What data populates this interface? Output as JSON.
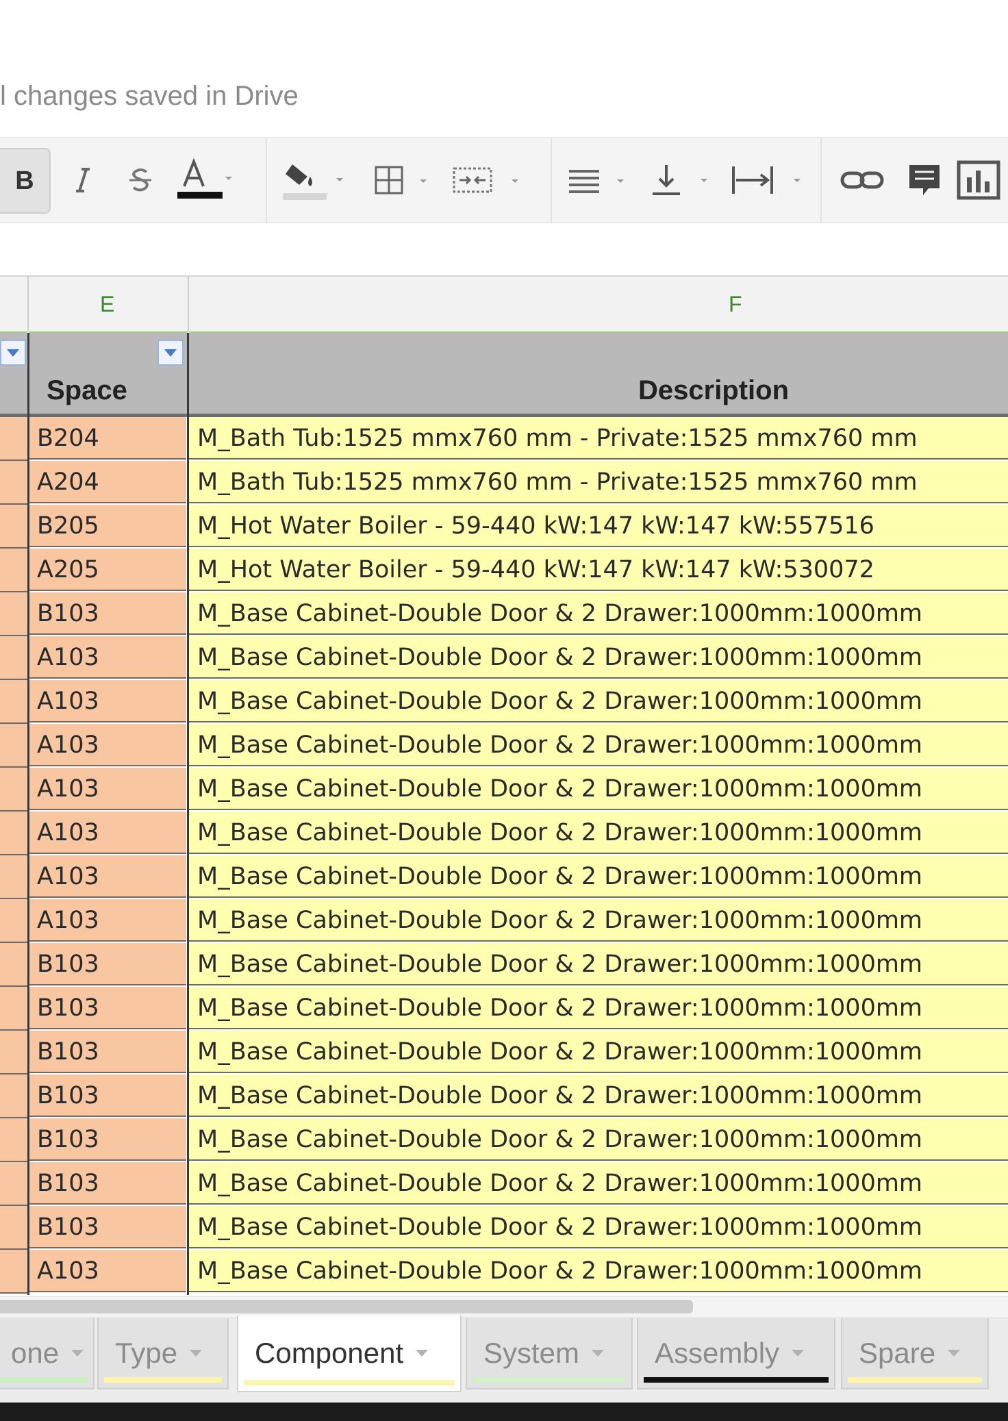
{
  "status": {
    "text": "l changes saved in Drive"
  },
  "toolbar": {
    "bold_label": "B",
    "text_color": "#111111",
    "fill_color": "#d6d6d6",
    "icons": [
      "italic-icon",
      "strikethrough-icon",
      "text-color-icon",
      "fill-color-icon",
      "borders-icon",
      "merge-cells-icon",
      "horizontal-align-icon",
      "vertical-align-icon",
      "text-wrap-icon",
      "link-icon",
      "comment-icon",
      "chart-icon"
    ]
  },
  "columns": {
    "e": "E",
    "f": "F"
  },
  "header": {
    "space": "Space",
    "description": "Description"
  },
  "rows": [
    {
      "space": "B204",
      "description": "M_Bath Tub:1525 mmx760 mm - Private:1525 mmx760 mm"
    },
    {
      "space": "A204",
      "description": "M_Bath Tub:1525 mmx760 mm - Private:1525 mmx760 mm"
    },
    {
      "space": "B205",
      "description": "M_Hot Water Boiler - 59-440 kW:147 kW:147 kW:557516"
    },
    {
      "space": "A205",
      "description": "M_Hot Water Boiler - 59-440 kW:147 kW:147 kW:530072"
    },
    {
      "space": "B103",
      "description": "M_Base Cabinet-Double Door & 2 Drawer:1000mm:1000mm"
    },
    {
      "space": "A103",
      "description": "M_Base Cabinet-Double Door & 2 Drawer:1000mm:1000mm"
    },
    {
      "space": "A103",
      "description": "M_Base Cabinet-Double Door & 2 Drawer:1000mm:1000mm"
    },
    {
      "space": "A103",
      "description": "M_Base Cabinet-Double Door & 2 Drawer:1000mm:1000mm"
    },
    {
      "space": "A103",
      "description": "M_Base Cabinet-Double Door & 2 Drawer:1000mm:1000mm"
    },
    {
      "space": "A103",
      "description": "M_Base Cabinet-Double Door & 2 Drawer:1000mm:1000mm"
    },
    {
      "space": "A103",
      "description": "M_Base Cabinet-Double Door & 2 Drawer:1000mm:1000mm"
    },
    {
      "space": "A103",
      "description": "M_Base Cabinet-Double Door & 2 Drawer:1000mm:1000mm"
    },
    {
      "space": "B103",
      "description": "M_Base Cabinet-Double Door & 2 Drawer:1000mm:1000mm"
    },
    {
      "space": "B103",
      "description": "M_Base Cabinet-Double Door & 2 Drawer:1000mm:1000mm"
    },
    {
      "space": "B103",
      "description": "M_Base Cabinet-Double Door & 2 Drawer:1000mm:1000mm"
    },
    {
      "space": "B103",
      "description": "M_Base Cabinet-Double Door & 2 Drawer:1000mm:1000mm"
    },
    {
      "space": "B103",
      "description": "M_Base Cabinet-Double Door & 2 Drawer:1000mm:1000mm"
    },
    {
      "space": "B103",
      "description": "M_Base Cabinet-Double Door & 2 Drawer:1000mm:1000mm"
    },
    {
      "space": "B103",
      "description": "M_Base Cabinet-Double Door & 2 Drawer:1000mm:1000mm"
    },
    {
      "space": "A103",
      "description": "M_Base Cabinet-Double Door & 2 Drawer:1000mm:1000mm"
    }
  ],
  "tabs": [
    {
      "label": "one",
      "underline": "#c9efc0"
    },
    {
      "label": "Type",
      "underline": "#fbf5a8"
    },
    {
      "label": "Component",
      "underline": "#fbf7b0"
    },
    {
      "label": "System",
      "underline": "#d3f0c9"
    },
    {
      "label": "Assembly",
      "underline": "#111111"
    },
    {
      "label": "Spare",
      "underline": "#fbf5a8"
    }
  ],
  "colors": {
    "space_cell": "#f8c6a0",
    "description_cell": "#ffffb0",
    "header_row": "#b9b9b9",
    "column_letter": "#3b8a2e"
  }
}
